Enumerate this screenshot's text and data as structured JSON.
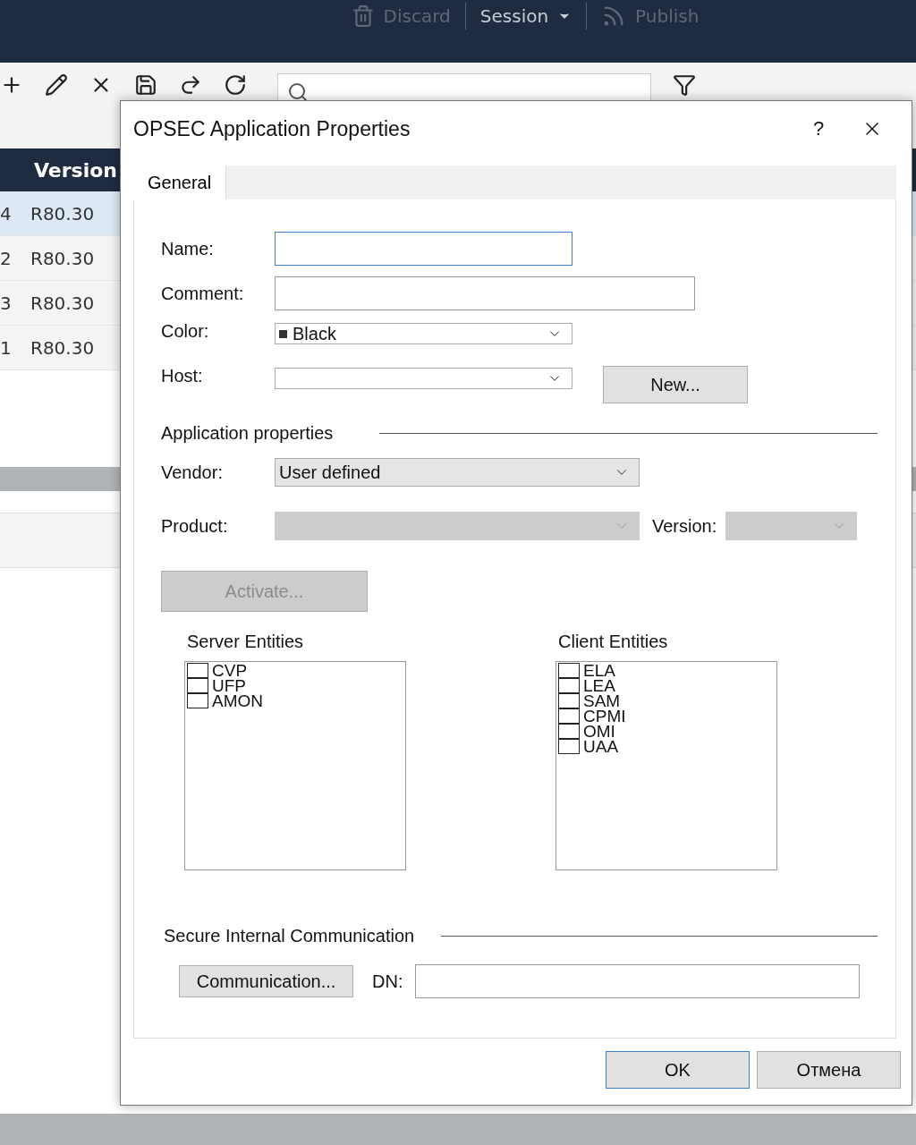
{
  "app_bar": {
    "actions": [
      {
        "kind": "discard",
        "label": "Discard",
        "disabled": true
      },
      {
        "kind": "session",
        "label": "Session",
        "disabled": false
      },
      {
        "kind": "publish",
        "label": "Publish",
        "disabled": true
      }
    ]
  },
  "table": {
    "columns": [
      "Version"
    ],
    "rows": [
      {
        "column_1": "4",
        "version": "R80.30",
        "selected": true
      },
      {
        "column_1": "2",
        "version": "R80.30",
        "selected": false
      },
      {
        "column_1": "3",
        "version": "R80.30",
        "selected": false
      },
      {
        "column_1": "1",
        "version": "R80.30",
        "selected": false
      }
    ]
  },
  "dialog": {
    "title": "OPSEC Application Properties",
    "help": "?",
    "tabs": [
      {
        "label": "General",
        "selected": true
      }
    ],
    "fields": [
      {
        "kind": "text",
        "label": "Name:",
        "focused": true
      },
      {
        "kind": "text",
        "label": "Comment:",
        "focused": false
      },
      {
        "kind": "color",
        "label": "Color:",
        "value": "Black",
        "color": "#333333"
      },
      {
        "kind": "select",
        "label": "Host:",
        "button": "New..."
      }
    ],
    "application_properties": {
      "title": "Application properties",
      "vendor": {
        "label": "Vendor:",
        "value": "User defined",
        "disabled": false
      },
      "product": {
        "label": "Product:",
        "disabled": true
      },
      "version": {
        "label": "Version:",
        "disabled": true
      },
      "activate": {
        "label": "Activate...",
        "disabled": true
      },
      "server_entities": {
        "title": "Server Entities",
        "items": [
          {
            "label": "CVP",
            "checked": false
          },
          {
            "label": "UFP",
            "checked": false
          },
          {
            "label": "AMON",
            "checked": false
          }
        ]
      },
      "client_entities": {
        "title": "Client Entities",
        "items": [
          {
            "label": "ELA",
            "checked": false
          },
          {
            "label": "LEA",
            "checked": false
          },
          {
            "label": "SAM",
            "checked": false
          },
          {
            "label": "CPMI",
            "checked": false
          },
          {
            "label": "OMI",
            "checked": false
          },
          {
            "label": "UAA",
            "checked": false
          }
        ]
      }
    },
    "secure_communication": {
      "title": "Secure Internal Communication",
      "button": "Communication...",
      "dn_label": "DN:"
    },
    "buttons": [
      {
        "label": "OK",
        "default": true
      },
      {
        "label": "Отмена",
        "default": false
      }
    ]
  }
}
